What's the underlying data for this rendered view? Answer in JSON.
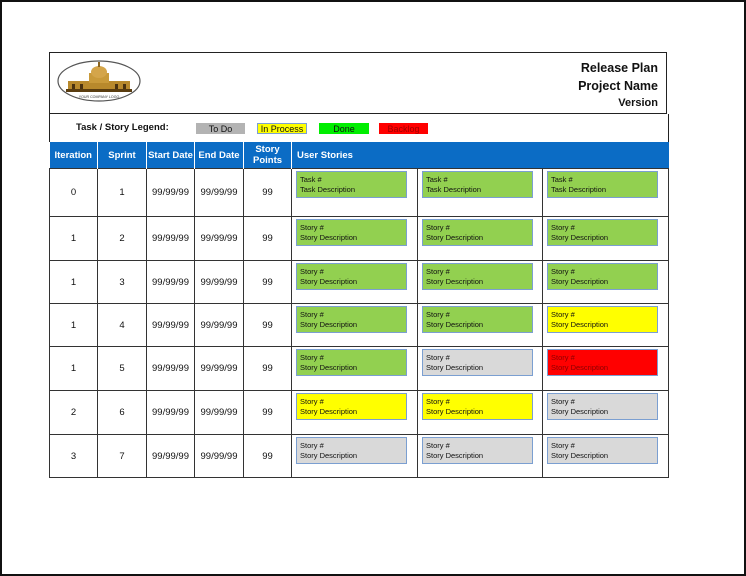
{
  "header": {
    "logo_text": "YOUR COMPANY LOGO",
    "title": "Release Plan",
    "project": "Project Name",
    "version": "Version"
  },
  "legend": {
    "label": "Task / Story Legend:",
    "items": [
      {
        "label": "To Do",
        "status": "todo",
        "color": "#b3b3b3",
        "text_color": "#111111",
        "border": "#b3b3b3"
      },
      {
        "label": "In Process",
        "status": "inprocess",
        "color": "#ffff00",
        "text_color": "#111111",
        "border": "#7b9fd1"
      },
      {
        "label": "Done",
        "status": "done",
        "color": "#00ee00",
        "text_color": "#111111",
        "border": "#00ee00"
      },
      {
        "label": "Backlog",
        "status": "backlog",
        "color": "#ff0000",
        "text_color": "#a00000",
        "border": "#ff0000"
      }
    ]
  },
  "status_colors": {
    "done": {
      "bg": "#92d050",
      "fg": "#111111"
    },
    "inprocess": {
      "bg": "#ffff00",
      "fg": "#111111"
    },
    "todo": {
      "bg": "#d9d9d9",
      "fg": "#111111"
    },
    "backlog": {
      "bg": "#ff0000",
      "fg": "#8b0000"
    }
  },
  "table": {
    "columns": [
      "Iteration",
      "Sprint",
      "Start Date",
      "End Date",
      "Story Points",
      "User Stories"
    ],
    "rows": [
      {
        "iteration": "0",
        "sprint": "1",
        "start": "99/99/99",
        "end": "99/99/99",
        "points": "99",
        "stories": [
          {
            "title": "Task #",
            "desc": "Task Description",
            "status": "done"
          },
          {
            "title": "Task #",
            "desc": "Task Description",
            "status": "done"
          },
          {
            "title": "Task #",
            "desc": "Task Description",
            "status": "done"
          }
        ]
      },
      {
        "iteration": "1",
        "sprint": "2",
        "start": "99/99/99",
        "end": "99/99/99",
        "points": "99",
        "stories": [
          {
            "title": "Story #",
            "desc": "Story Description",
            "status": "done"
          },
          {
            "title": "Story #",
            "desc": "Story Description",
            "status": "done"
          },
          {
            "title": "Story #",
            "desc": "Story Description",
            "status": "done"
          }
        ]
      },
      {
        "iteration": "1",
        "sprint": "3",
        "start": "99/99/99",
        "end": "99/99/99",
        "points": "99",
        "stories": [
          {
            "title": "Story #",
            "desc": "Story Description",
            "status": "done"
          },
          {
            "title": "Story #",
            "desc": "Story Description",
            "status": "done"
          },
          {
            "title": "Story #",
            "desc": "Story Description",
            "status": "done"
          }
        ]
      },
      {
        "iteration": "1",
        "sprint": "4",
        "start": "99/99/99",
        "end": "99/99/99",
        "points": "99",
        "stories": [
          {
            "title": "Story #",
            "desc": "Story Description",
            "status": "done"
          },
          {
            "title": "Story #",
            "desc": "Story Description",
            "status": "done"
          },
          {
            "title": "Story #",
            "desc": "Story Description",
            "status": "inprocess"
          }
        ]
      },
      {
        "iteration": "1",
        "sprint": "5",
        "start": "99/99/99",
        "end": "99/99/99",
        "points": "99",
        "stories": [
          {
            "title": "Story #",
            "desc": "Story Description",
            "status": "done"
          },
          {
            "title": "Story #",
            "desc": "Story Description",
            "status": "todo"
          },
          {
            "title": "Story #",
            "desc": "Story Description",
            "status": "backlog"
          }
        ]
      },
      {
        "iteration": "2",
        "sprint": "6",
        "start": "99/99/99",
        "end": "99/99/99",
        "points": "99",
        "stories": [
          {
            "title": "Story #",
            "desc": "Story Description",
            "status": "inprocess"
          },
          {
            "title": "Story #",
            "desc": "Story Description",
            "status": "inprocess"
          },
          {
            "title": "Story #",
            "desc": "Story Description",
            "status": "todo"
          }
        ]
      },
      {
        "iteration": "3",
        "sprint": "7",
        "start": "99/99/99",
        "end": "99/99/99",
        "points": "99",
        "stories": [
          {
            "title": "Story #",
            "desc": "Story Description",
            "status": "todo"
          },
          {
            "title": "Story #",
            "desc": "Story Description",
            "status": "todo"
          },
          {
            "title": "Story #",
            "desc": "Story Description",
            "status": "todo"
          }
        ]
      }
    ]
  }
}
